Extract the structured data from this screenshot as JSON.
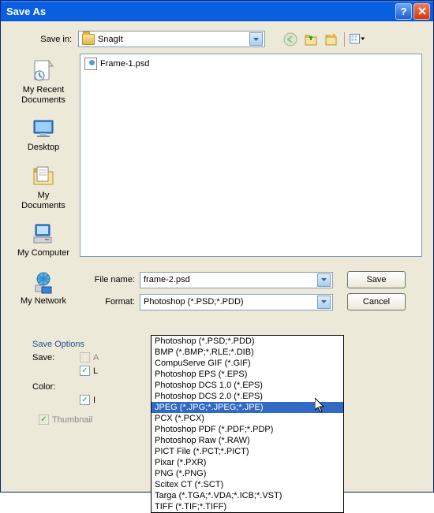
{
  "titlebar": {
    "title": "Save As"
  },
  "savein": {
    "label": "Save in:",
    "value": "SnagIt"
  },
  "files": [
    {
      "name": "Frame-1.psd"
    }
  ],
  "places": [
    {
      "label": "My Recent Documents"
    },
    {
      "label": "Desktop"
    },
    {
      "label": "My Documents"
    },
    {
      "label": "My Computer"
    },
    {
      "label": "My Network"
    }
  ],
  "filename": {
    "label": "File name:",
    "value": "frame-2.psd"
  },
  "format": {
    "label": "Format:",
    "value": "Photoshop (*.PSD;*.PDD)"
  },
  "buttons": {
    "save": "Save",
    "cancel": "Cancel"
  },
  "formats": [
    "Photoshop (*.PSD;*.PDD)",
    "BMP (*.BMP;*.RLE;*.DIB)",
    "CompuServe GIF (*.GIF)",
    "Photoshop EPS (*.EPS)",
    "Photoshop DCS 1.0 (*.EPS)",
    "Photoshop DCS 2.0 (*.EPS)",
    "JPEG (*.JPG;*.JPEG;*.JPE)",
    "PCX (*.PCX)",
    "Photoshop PDF (*.PDF;*.PDP)",
    "Photoshop Raw (*.RAW)",
    "PICT File (*.PCT;*.PICT)",
    "Pixar (*.PXR)",
    "PNG (*.PNG)",
    "Scitex CT (*.SCT)",
    "Targa (*.TGA;*.VDA;*.ICB;*.VST)",
    "TIFF (*.TIF;*.TIFF)"
  ],
  "formats_selected_index": 6,
  "save_options": {
    "title": "Save Options",
    "save_label": "Save:",
    "color_label": "Color:",
    "as_copy": "As a Copy",
    "layers": "Layers",
    "icc": "ICC Profile",
    "thumbnail": "Thumbnail"
  }
}
